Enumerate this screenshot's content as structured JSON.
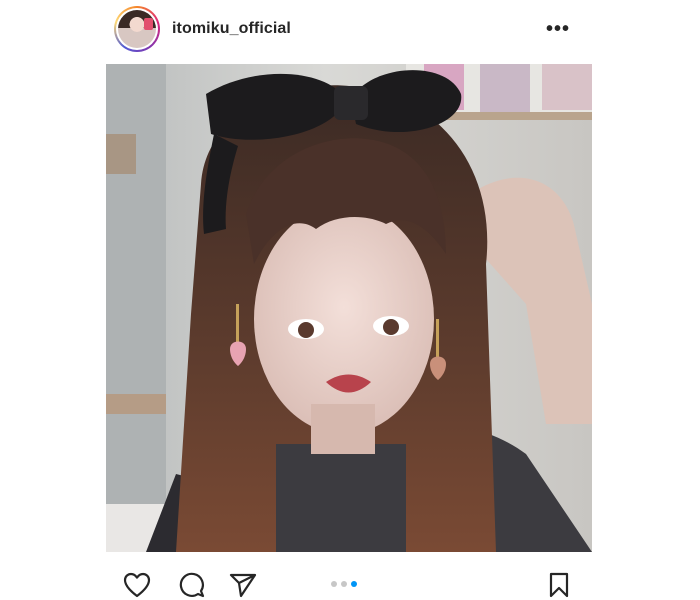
{
  "post": {
    "username": "itomiku_official",
    "more_icon": "more-horizontal-icon",
    "photo_alt": "itomiku_official post photo",
    "carousel": {
      "total": 3,
      "active": 3
    },
    "actions": {
      "like_icon": "heart-icon",
      "comment_icon": "comment-icon",
      "share_icon": "send-icon",
      "save_icon": "bookmark-icon"
    },
    "colors": {
      "accent": "#0095f6",
      "text": "#262626"
    }
  }
}
